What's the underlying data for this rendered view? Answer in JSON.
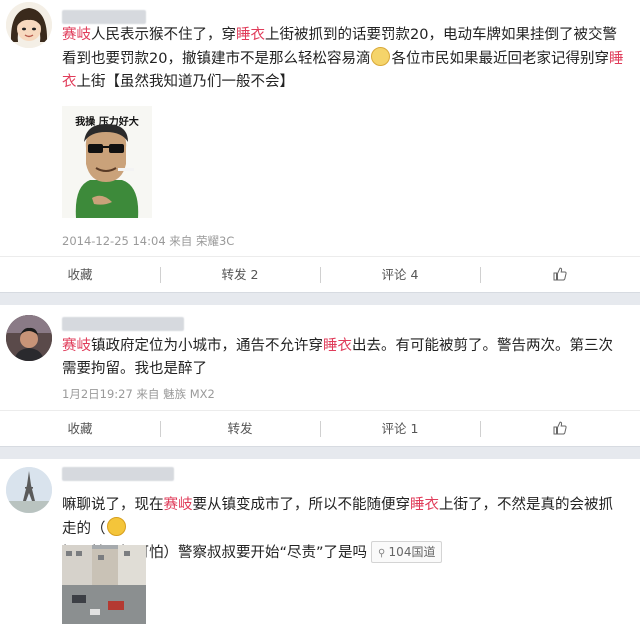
{
  "posts": [
    {
      "text": {
        "p1": "赛岐",
        "p2": "人民表示猴不住了，穿",
        "p3": "睡衣",
        "p4": "上街被抓到的话要罚款20，电动车牌如果挂倒了被交警看到也要罚款20，撤镇建市不是那么轻松容易滴",
        "p5": "各位市民如果最近回老家记得别穿",
        "p6": "睡衣",
        "p7": "上街【虽然我知道乃们一般不会】"
      },
      "meme_caption": "我操 压力好大",
      "meta": "2014-12-25 14:04  来自 荣耀3C",
      "actions": [
        "收藏",
        "转发 2",
        "评论 4"
      ]
    },
    {
      "text": {
        "p1": "赛岐",
        "p2": "镇政府定位为小城市，通告不允许穿",
        "p3": "睡衣",
        "p4": "出去。有可能被剪了。警告两次。第三次需要拘留。我也是醉了"
      },
      "meta": "1月2日19:27  来自 魅族 MX2",
      "actions": [
        "收藏",
        "转发",
        "评论 1"
      ]
    },
    {
      "text": {
        "p1": "嘛聊说了，现在",
        "p2": "赛岐",
        "p3": "要从镇变成市了，所以不能随便穿",
        "p4": "睡衣",
        "p5": "上街了，不然是真的会被抓走的（",
        "p6": "好可怕，好可怕）警察叔叔要开始“尽责”了是吗"
      },
      "location_tag": "104国道"
    }
  ],
  "icons": {
    "like": "thumbs-up-icon",
    "location": "location-pin-icon"
  },
  "colors": {
    "highlight": "#e03c5a",
    "divider": "#e6e9ee",
    "meta": "#9a9a9a"
  }
}
